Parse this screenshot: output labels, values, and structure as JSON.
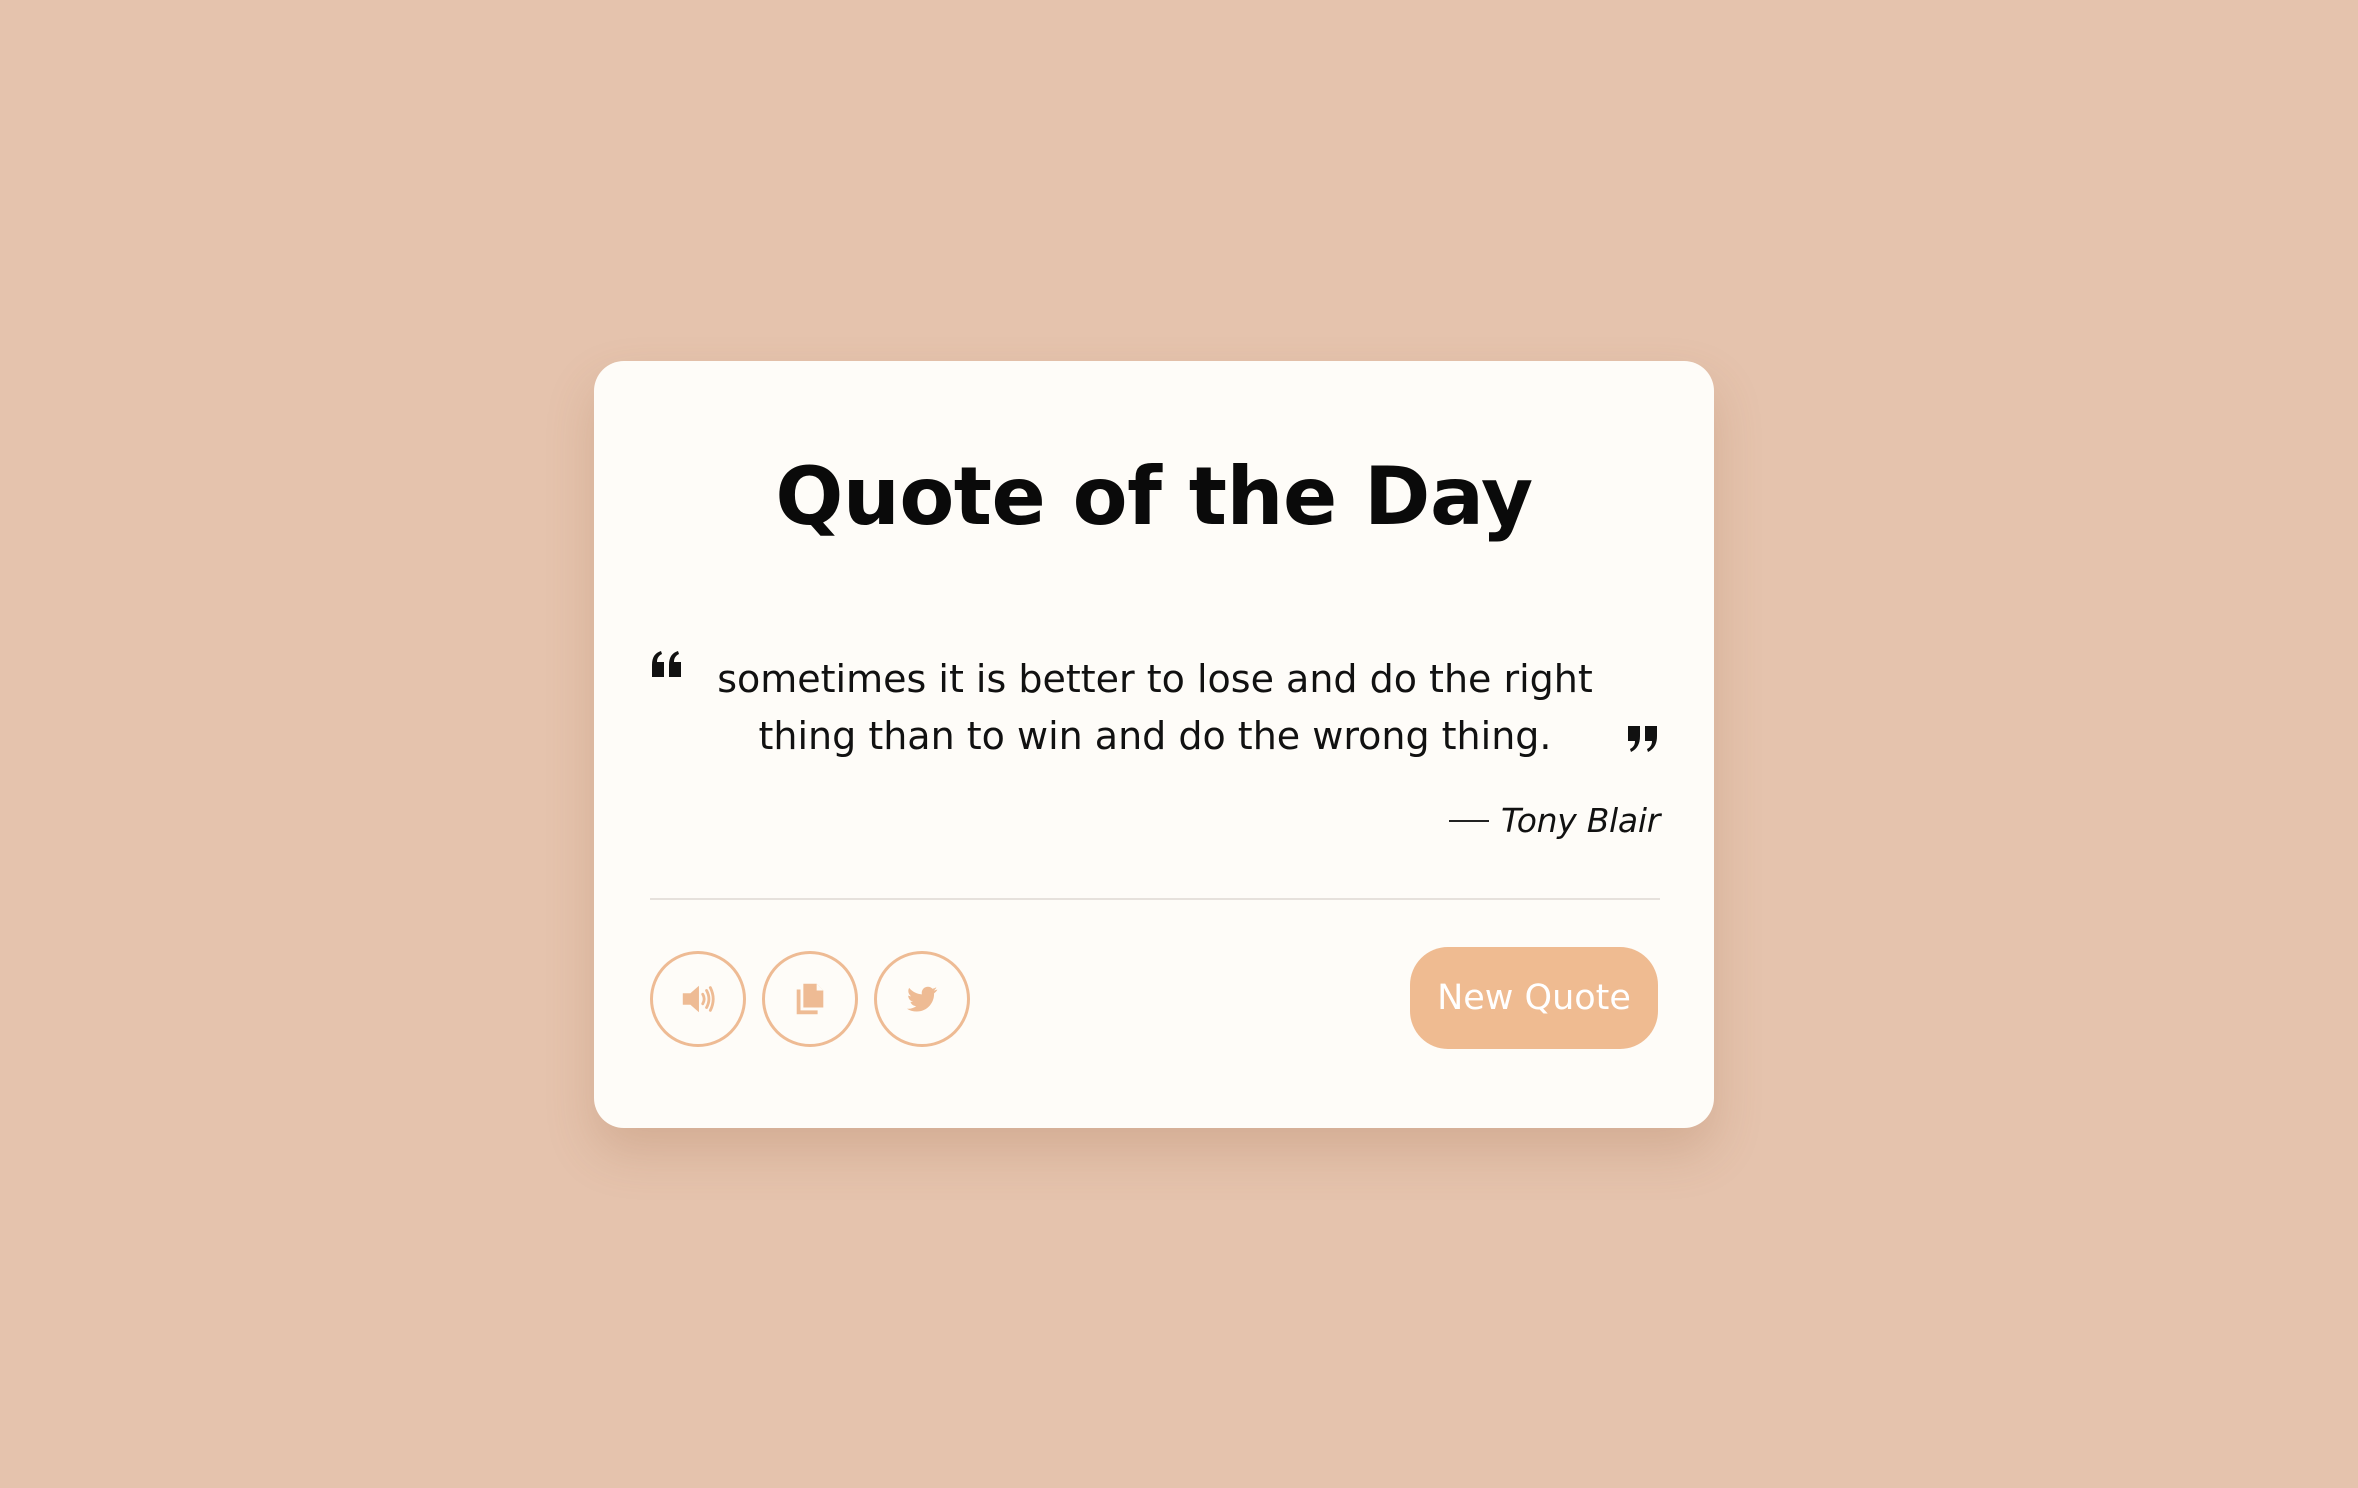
{
  "card": {
    "title": "Quote of the Day",
    "quote": "sometimes it is better to lose and do the right thing than to win and do the wrong thing.",
    "author": "Tony Blair",
    "new_quote_label": "New Quote"
  },
  "actions": {
    "speak_icon": "speaker-icon",
    "copy_icon": "copy-icon",
    "tweet_icon": "twitter-icon"
  },
  "colors": {
    "background": "#e5c3ad",
    "card": "#fefcf8",
    "accent": "#efbb91",
    "accent_border": "#eebb94",
    "text": "#0a0a0a"
  }
}
